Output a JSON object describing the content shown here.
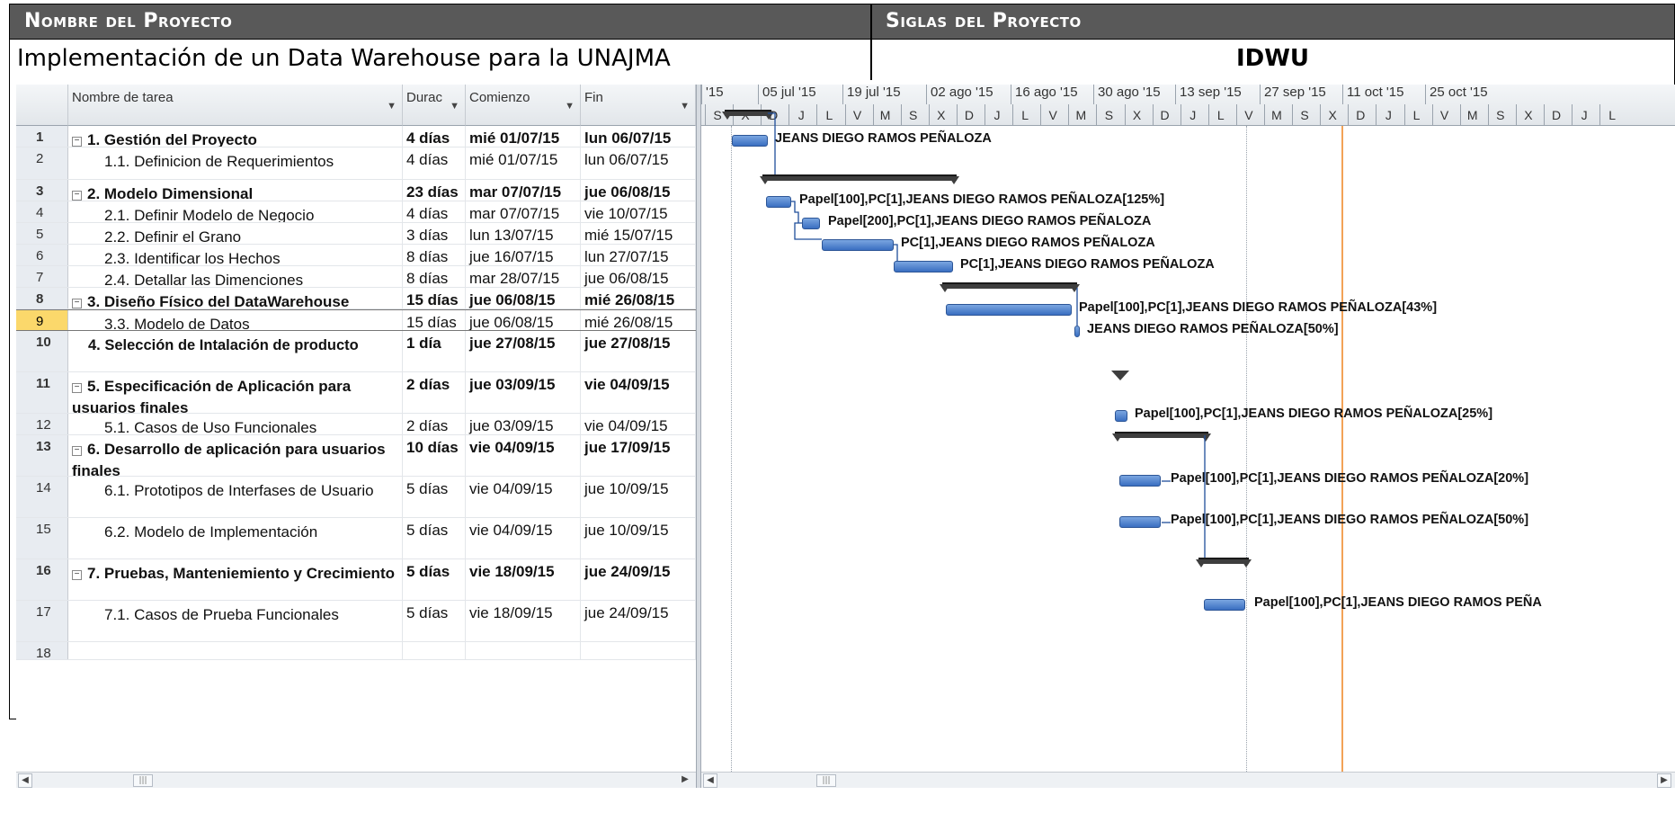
{
  "header": {
    "name_label": "Nombre del Proyecto",
    "name_value": "Implementación de un Data Warehouse para la UNAJMA",
    "acronym_label": "Siglas del Proyecto",
    "acronym_value": "IDWU"
  },
  "grid": {
    "columns": [
      "Nombre de tarea",
      "Durac",
      "Comienzo",
      "Fin"
    ],
    "rows": [
      {
        "id": "1",
        "name": "1. Gestión del Proyecto",
        "dur": "4 días",
        "start": "mié 01/07/15",
        "end": "lun 06/07/15",
        "summary": true
      },
      {
        "id": "2",
        "name": "1.1. Definicion de Requerimientos",
        "dur": "4 días",
        "start": "mié 01/07/15",
        "end": "lun 06/07/15",
        "summary": false
      },
      {
        "id": "3",
        "name": "2. Modelo Dimensional",
        "dur": "23 días",
        "start": "mar 07/07/15",
        "end": "jue 06/08/15",
        "summary": true
      },
      {
        "id": "4",
        "name": "2.1. Definir Modelo de Negocio",
        "dur": "4 días",
        "start": "mar 07/07/15",
        "end": "vie 10/07/15",
        "summary": false
      },
      {
        "id": "5",
        "name": "2.2. Definir el Grano",
        "dur": "3 días",
        "start": "lun 13/07/15",
        "end": "mié 15/07/15",
        "summary": false
      },
      {
        "id": "6",
        "name": "2.3. Identificar los Hechos",
        "dur": "8 días",
        "start": "jue 16/07/15",
        "end": "lun 27/07/15",
        "summary": false
      },
      {
        "id": "7",
        "name": "2.4. Detallar las Dimenciones",
        "dur": "8 días",
        "start": "mar 28/07/15",
        "end": "jue 06/08/15",
        "summary": false
      },
      {
        "id": "8",
        "name": "3. Diseño Físico del DataWarehouse",
        "dur": "15 días",
        "start": "jue 06/08/15",
        "end": "mié 26/08/15",
        "summary": true
      },
      {
        "id": "9",
        "name": "3.3. Modelo de Datos",
        "dur": "15 días",
        "start": "jue 06/08/15",
        "end": "mié 26/08/15",
        "summary": false
      },
      {
        "id": "10",
        "name": "4. Selección de Intalación de producto",
        "dur": "1 día",
        "start": "jue 27/08/15",
        "end": "jue 27/08/15",
        "summary": true
      },
      {
        "id": "11",
        "name": "5. Especificación de Aplicación para usuarios finales",
        "dur": "2 días",
        "start": "jue 03/09/15",
        "end": "vie 04/09/15",
        "summary": true
      },
      {
        "id": "12",
        "name": "5.1. Casos de Uso Funcionales",
        "dur": "2 días",
        "start": "jue 03/09/15",
        "end": "vie 04/09/15",
        "summary": false
      },
      {
        "id": "13",
        "name": "6. Desarrollo de aplicación para usuarios finales",
        "dur": "10 días",
        "start": "vie 04/09/15",
        "end": "jue 17/09/15",
        "summary": true
      },
      {
        "id": "14",
        "name": "6.1. Prototipos de Interfases de Usuario",
        "dur": "5 días",
        "start": "vie 04/09/15",
        "end": "jue 10/09/15",
        "summary": false
      },
      {
        "id": "15",
        "name": "6.2. Modelo de Implementación",
        "dur": "5 días",
        "start": "vie 04/09/15",
        "end": "jue 10/09/15",
        "summary": false
      },
      {
        "id": "16",
        "name": "7. Pruebas, Manteniemiento y Crecimiento",
        "dur": "5 días",
        "start": "vie 18/09/15",
        "end": "jue 24/09/15",
        "summary": true
      },
      {
        "id": "17",
        "name": "7.1. Casos de Prueba Funcionales",
        "dur": "5 días",
        "start": "vie 18/09/15",
        "end": "jue 24/09/15",
        "summary": false
      },
      {
        "id": "18",
        "name": "",
        "dur": "",
        "start": "",
        "end": "",
        "summary": false
      }
    ]
  },
  "timescale": {
    "major": [
      "'15",
      "05 jul '15",
      "19 jul '15",
      "02 ago '15",
      "16 ago '15",
      "30 ago '15",
      "13 sep '15",
      "27 sep '15",
      "11 oct '15",
      "25 oct '15"
    ],
    "minor": [
      "S",
      "X",
      "D",
      "J",
      "L",
      "V",
      "M",
      "S",
      "X",
      "D",
      "J",
      "L",
      "V",
      "M",
      "S",
      "X",
      "D",
      "J",
      "L",
      "V",
      "M",
      "S",
      "X",
      "D",
      "J",
      "L",
      "V",
      "M",
      "S",
      "X",
      "D",
      "J",
      "L"
    ]
  },
  "bar_labels": {
    "r2": "JEANS DIEGO RAMOS PEÑALOZA",
    "r4": "Papel[100],PC[1],JEANS DIEGO RAMOS PEÑALOZA[125%]",
    "r5": "Papel[200],PC[1],JEANS DIEGO RAMOS PEÑALOZA",
    "r6": "PC[1],JEANS DIEGO RAMOS PEÑALOZA",
    "r7": "PC[1],JEANS DIEGO RAMOS PEÑALOZA",
    "r9": "Papel[100],PC[1],JEANS DIEGO RAMOS PEÑALOZA[43%]",
    "r10": "JEANS DIEGO RAMOS PEÑALOZA[50%]",
    "r12": "Papel[100],PC[1],JEANS DIEGO RAMOS PEÑALOZA[25%]",
    "r14": "Papel[100],PC[1],JEANS DIEGO RAMOS PEÑALOZA[20%]",
    "r15": "Papel[100],PC[1],JEANS DIEGO RAMOS PEÑALOZA[50%]",
    "r17": "Papel[100],PC[1],JEANS DIEGO RAMOS PEÑA"
  },
  "scrollbar": {
    "thumb": "|||"
  }
}
